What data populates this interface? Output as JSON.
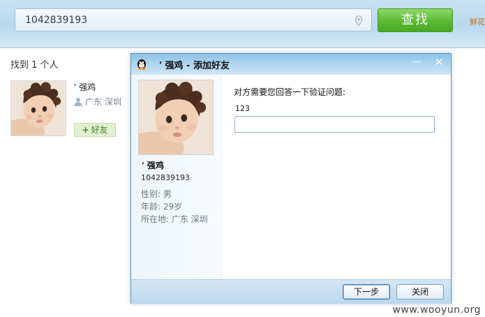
{
  "search": {
    "query": "1042839193",
    "find_label": "查找",
    "side_tag": "鲜花"
  },
  "results": {
    "found_text": "找到 1 个人",
    "items": [
      {
        "name": "' 强鸡",
        "location": "广东 深圳",
        "add_label": "好友",
        "add_icon": "+"
      }
    ]
  },
  "dialog": {
    "title": "'    强鸡 - 添加好友",
    "minimize_icon": "—",
    "close_icon": "✕",
    "profile": {
      "name": "'    强鸡",
      "qq": "1042839193",
      "gender": "性别: 男",
      "age": "年龄: 29岁",
      "location": "所在地: 广东  深圳"
    },
    "question_prompt": "对方需要您回答一下验证问题:",
    "question": "123",
    "answer_value": "",
    "next_label": "下一步",
    "close_label": "关闭"
  },
  "watermark": "www.wooyun.org",
  "colors": {
    "find_button": "#5cbd35",
    "title_bar": "#a9d2ee",
    "add_friend": "#3e8a1e"
  }
}
